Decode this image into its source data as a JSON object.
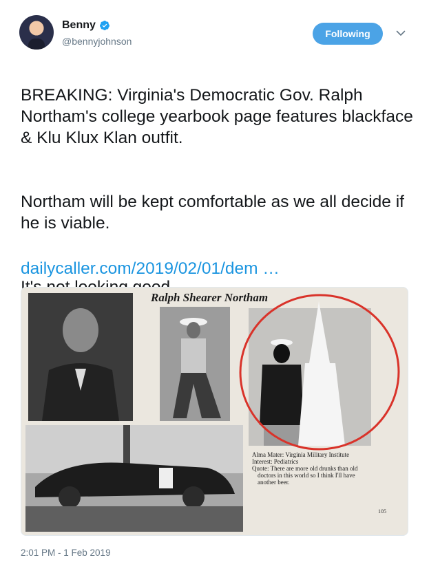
{
  "author": {
    "display_name": "Benny",
    "handle": "@bennyjohnson",
    "verified": true,
    "avatar_icon": "profile-avatar"
  },
  "follow_button": {
    "label": "Following",
    "color": "#4ba3e6"
  },
  "menu_icon": "chevron-down-icon",
  "tweet": {
    "paragraphs": [
      "BREAKING: Virginia's Democratic Gov. Ralph Northam's college yearbook page features blackface & Klu Klux Klan outfit.",
      "Northam will be kept comfortable as we all decide if he is viable.",
      "It's not looking good."
    ],
    "link_text": "dailycaller.com/2019/02/01/dem …",
    "link_color": "#1b95e0"
  },
  "media": {
    "yearbook_title": "Ralph Shearer Northam",
    "caption_lines": [
      "Alma Mater: Virginia Military Institute",
      "Interest: Pediatrics",
      "Quote: There are more old drunks than old",
      "doctors in this world so I think I'll have",
      "another beer."
    ],
    "page_number": "105",
    "highlight_color": "#d9332a"
  },
  "timestamp": "2:01 PM - 1 Feb 2019"
}
